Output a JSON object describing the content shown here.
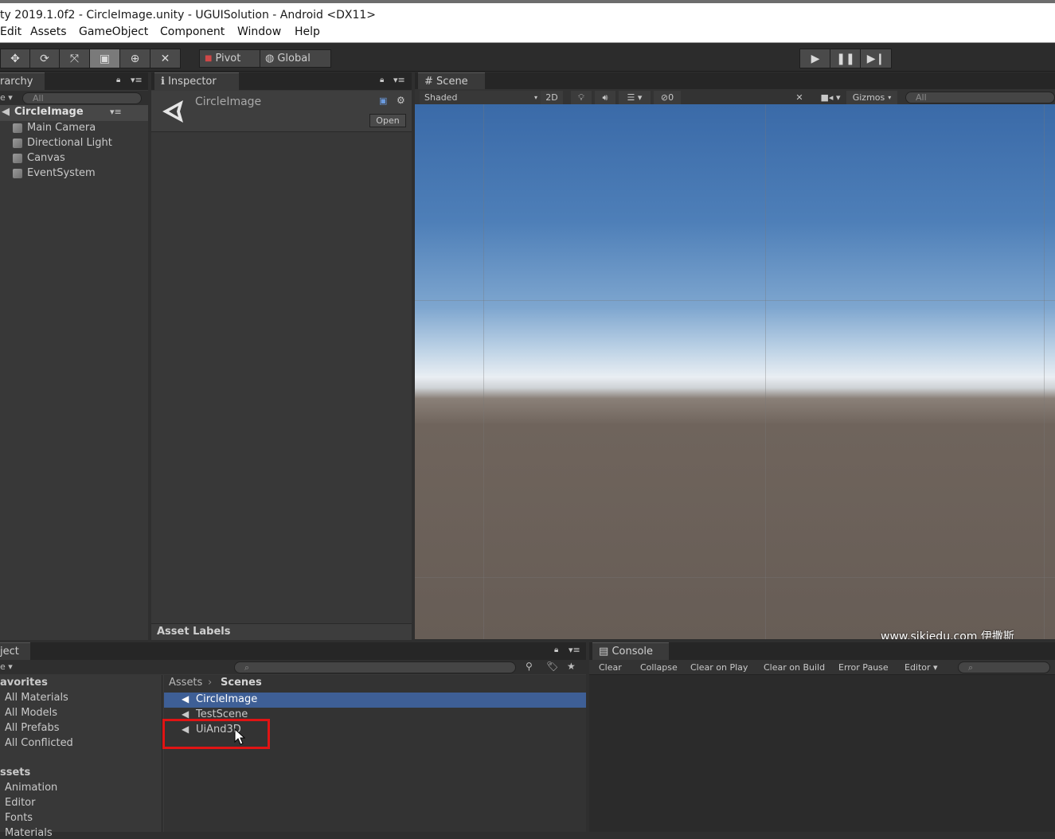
{
  "window": {
    "title": "ty 2019.1.0f2 - CircleImage.unity - UGUISolution - Android <DX11>"
  },
  "menu": [
    "Edit",
    "Assets",
    "GameObject",
    "Component",
    "Window",
    "Help"
  ],
  "toolbar": {
    "pivot": "Pivot",
    "global": "Global"
  },
  "hierarchy": {
    "tab": "rarchy",
    "search_placeholder": "All",
    "create": "e ▾",
    "scene": "CircleImage",
    "items": [
      "Main Camera",
      "Directional Light",
      "Canvas",
      "EventSystem"
    ]
  },
  "inspector": {
    "tab": "Inspector",
    "object_name": "CircleImage",
    "open_button": "Open",
    "asset_labels": "Asset Labels"
  },
  "scene": {
    "tab": "Scene",
    "shading": "Shaded",
    "mode_2d": "2D",
    "hidden_count": "0",
    "gizmos": "Gizmos",
    "search_placeholder": "All"
  },
  "project": {
    "tab": "ject",
    "create": "e ▾",
    "favorites_header": "avorites",
    "favorites": [
      "All Materials",
      "All Models",
      "All Prefabs",
      "All Conflicted"
    ],
    "assets_header": "ssets",
    "folders": [
      "Animation",
      "Editor",
      "Fonts",
      "Materials"
    ],
    "breadcrumb": [
      "Assets",
      "Scenes"
    ],
    "files": [
      "CircleImage",
      "TestScene",
      "UiAnd3D"
    ],
    "selected_file": "CircleImage"
  },
  "console": {
    "tab": "Console",
    "buttons": [
      "Clear",
      "Collapse",
      "Clear on Play",
      "Clear on Build",
      "Error Pause",
      "Editor ▾"
    ]
  },
  "watermark": "www.sikiedu.com 伊撒斯",
  "colors": {
    "selection": "#3e5f96",
    "highlight_box": "#e01414",
    "panel": "#383838"
  }
}
